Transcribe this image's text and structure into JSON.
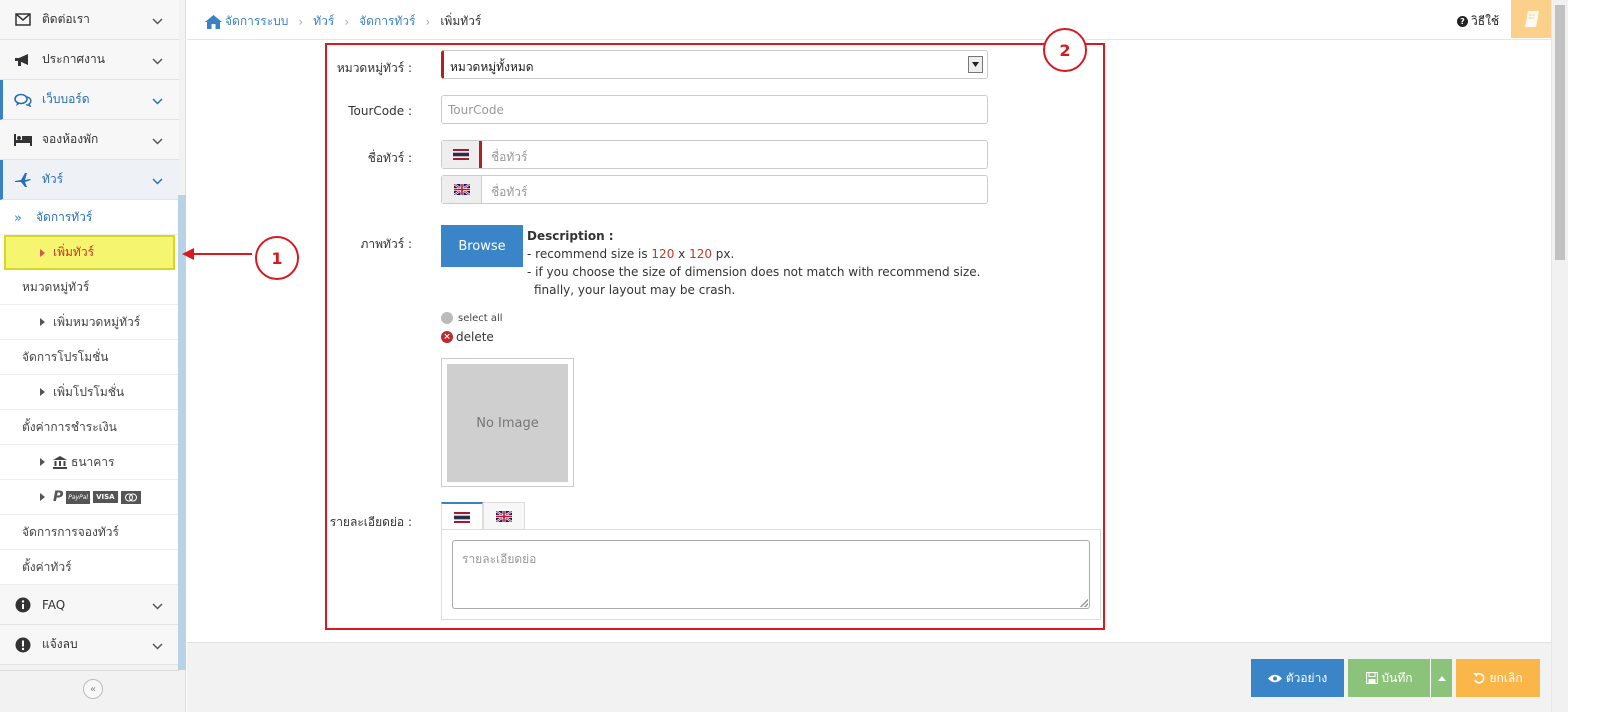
{
  "sidebar": {
    "menu_top": [
      {
        "label": "ติดต่อเรา",
        "icon": "envelope-icon"
      },
      {
        "label": "ประกาศงาน",
        "icon": "megaphone-icon"
      },
      {
        "label": "เว็บบอร์ด",
        "icon": "comments-icon"
      },
      {
        "label": "จองห้องพัก",
        "icon": "bed-icon"
      },
      {
        "label": "ทัวร์",
        "icon": "plane-icon"
      }
    ],
    "tour_sub": {
      "manage_tour": "จัดการทัวร์",
      "add_tour": "เพิ่มทัวร์",
      "tour_category": "หมวดหมู่ทัวร์",
      "add_category": "เพิ่มหมวดหมู่ทัวร์",
      "manage_promotion": "จัดการโปรโมชั่น",
      "add_promotion": "เพิ่มโปรโมชั่น",
      "payment_settings": "ตั้งค่าการชำระเงิน",
      "bank": "ธนาคาร",
      "payment_logos": [
        "PayPal",
        "VISA"
      ],
      "manage_booking": "จัดการการจองทัวร์",
      "tour_settings": "ตั้งค่าทัวร์"
    },
    "menu_bottom": [
      {
        "label": "FAQ",
        "icon": "info-icon"
      },
      {
        "label": "แจ้งลบ",
        "icon": "exclamation-icon"
      }
    ]
  },
  "breadcrumb": {
    "home": "จัดการระบบ",
    "tour": "ทัวร์",
    "manage": "จัดการทัวร์",
    "current": "เพิ่มทัวร์"
  },
  "topbar": {
    "help_label": "วิธีใช้"
  },
  "form": {
    "category_label": "หมวดหมู่ทัวร์ :",
    "category_value": "หมวดหมู่ทั้งหมด",
    "tourcode_label": "TourCode :",
    "tourcode_placeholder": "TourCode",
    "name_label": "ชื่อทัวร์ :",
    "name_th_placeholder": "ชื่อทัวร์",
    "name_en_placeholder": "ชื่อทัวร์",
    "image_label": "ภาพทัวร์ :",
    "browse_label": "Browse",
    "desc_title": "Description :",
    "desc_line1_pre": "- recommend size is ",
    "desc_w": "120",
    "desc_x": " x ",
    "desc_h": "120",
    "desc_line1_post": " px.",
    "desc_line2": "- if you choose the size of dimension does not match with recommend size.",
    "desc_line3": "finally, your layout may be crash.",
    "select_all": "select all",
    "delete": "delete",
    "no_image": "No Image",
    "short_desc_label": "รายละเอียดย่อ :",
    "short_desc_placeholder": "รายละเอียดย่อ"
  },
  "callouts": {
    "one": "1",
    "two": "2"
  },
  "footer": {
    "preview": "ตัวอย่าง",
    "save": "บันทึก",
    "cancel": "ยกเลิก"
  },
  "colors": {
    "accent": "#3a85c7",
    "highlight": "#f5f570",
    "annotation_red": "#d71920",
    "save_green": "#8bc37b",
    "cancel_orange": "#fbb64a"
  }
}
